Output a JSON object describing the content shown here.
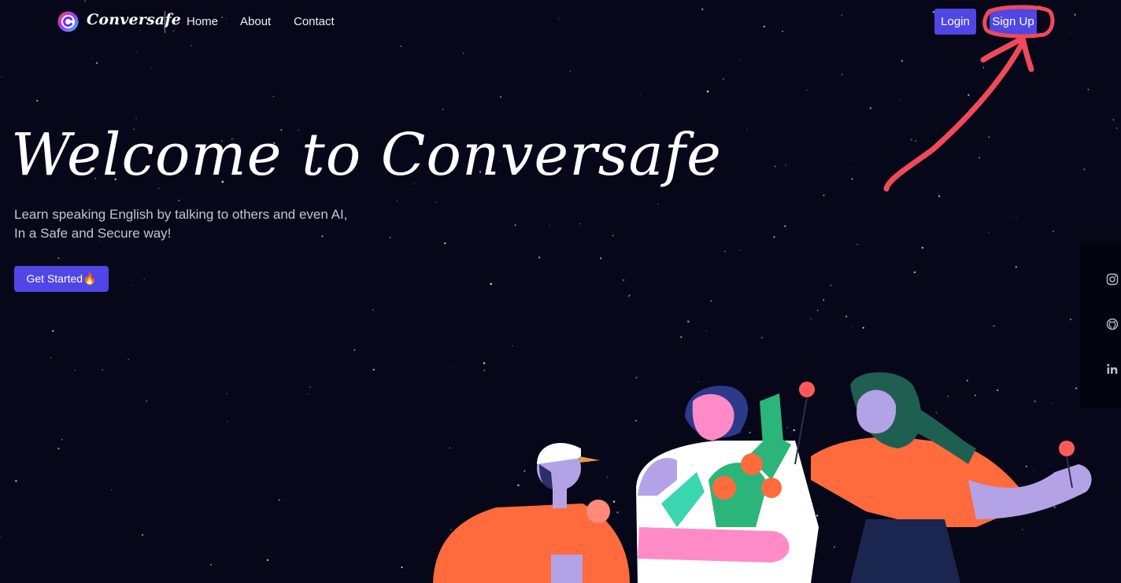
{
  "brand": {
    "name": "Conversafe",
    "logo_icon": "c-logo-icon"
  },
  "nav": {
    "links": [
      "Home",
      "About",
      "Contact"
    ]
  },
  "auth": {
    "login_label": "Login",
    "signup_label": "Sign Up"
  },
  "hero": {
    "title": "Welcome to Conversafe",
    "subtitle_line1": "Learn speaking English by talking to others and even AI,",
    "subtitle_line2": "In a Safe and Secure way!",
    "cta_label": "Get Started🔥"
  },
  "social": {
    "icons": [
      "instagram-icon",
      "github-icon",
      "linkedin-icon"
    ]
  },
  "colors": {
    "background": "#07071a",
    "accent": "#4f46e5",
    "annotation": "#f04a5a"
  }
}
